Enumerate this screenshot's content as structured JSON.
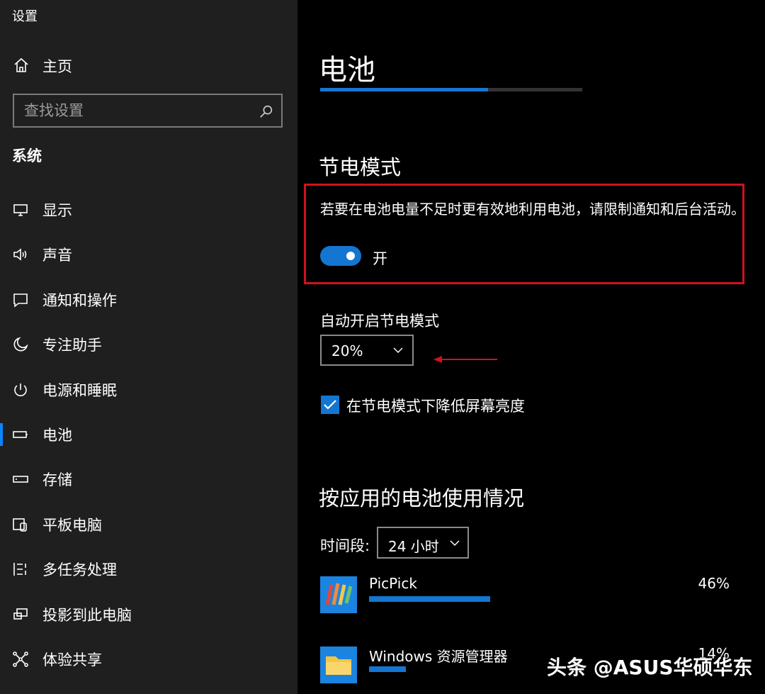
{
  "window": {
    "title": "设置"
  },
  "sidebar": {
    "home_label": "主页",
    "search_placeholder": "查找设置",
    "section_label": "系统",
    "items": [
      {
        "label": "显示",
        "icon": "monitor-icon"
      },
      {
        "label": "声音",
        "icon": "speaker-icon"
      },
      {
        "label": "通知和操作",
        "icon": "notification-icon"
      },
      {
        "label": "专注助手",
        "icon": "moon-icon"
      },
      {
        "label": "电源和睡眠",
        "icon": "power-icon"
      },
      {
        "label": "电池",
        "icon": "battery-icon",
        "active": true
      },
      {
        "label": "存储",
        "icon": "storage-icon"
      },
      {
        "label": "平板电脑",
        "icon": "tablet-icon"
      },
      {
        "label": "多任务处理",
        "icon": "multitask-icon"
      },
      {
        "label": "投影到此电脑",
        "icon": "project-icon"
      },
      {
        "label": "体验共享",
        "icon": "share-icon"
      }
    ]
  },
  "main": {
    "title": "电池",
    "battery_progress": 0.64,
    "saver": {
      "heading": "节电模式",
      "description": "若要在电池电量不足时更有效地利用电池，请限制通知和后台活动。",
      "toggle_state": "开",
      "auto_label": "自动开启节电模式",
      "auto_value": "20%",
      "checkbox_label": "在节电模式下降低屏幕亮度",
      "checkbox_checked": true
    },
    "usage": {
      "heading": "按应用的电池使用情况",
      "period_label": "时间段:",
      "period_value": "24 小时",
      "apps": [
        {
          "name": "PicPick",
          "percent": "46%",
          "fraction": 0.46
        },
        {
          "name": "Windows 资源管理器",
          "percent": "14%",
          "fraction": 0.14
        }
      ]
    }
  },
  "watermark": "头条 @ASUS华硕华东",
  "colors": {
    "accent": "#1476d0",
    "highlight_box": "#d0121b",
    "sidebar_bg": "#1f1f1f"
  }
}
